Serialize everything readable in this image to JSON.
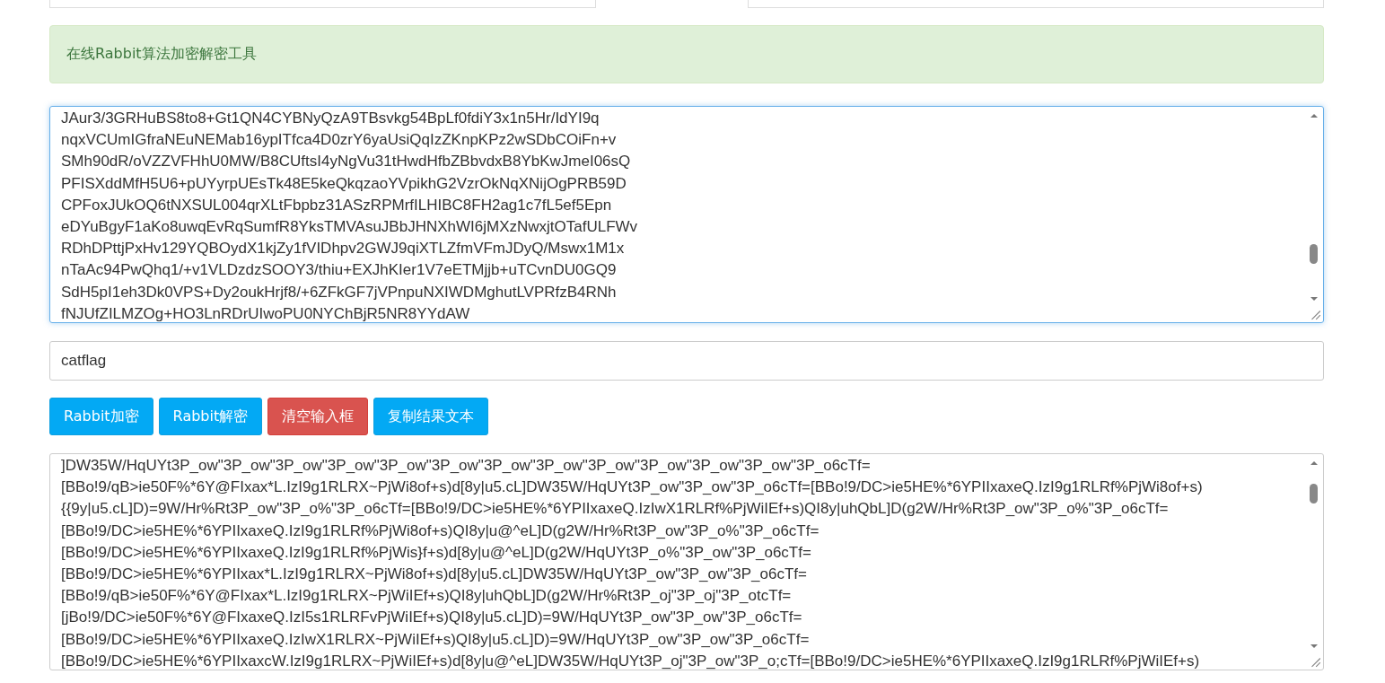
{
  "alert": {
    "text": "在线Rabbit算法加密解密工具"
  },
  "input_text": {
    "focused": true,
    "lines": [
      "JAur3/3GRHuBS8to8+Gt1QN4CYBNyQzA9TBsvkg54BpLf0fdiY3x1n5Hr/IdYI9q",
      "nqxVCUmIGfraNEuNEMab16ypITfca4D0zrY6yaUsiQqIzZKnpKPz2wSDbCOiFn+v",
      "SMh90dR/oVZZVFHhU0MW/B8CUftsI4yNgVu31tHwdHfbZBbvdxB8YbKwJmeI06sQ",
      "PFISXddMfH5U6+pUYyrpUEsTk48E5keQkqzaoYVpikhG2VzrOkNqXNijOgPRB59D",
      "CPFoxJUkOQ6tNXSUL004qrXLtFbpbz31ASzRPMrfILHIBC8FH2ag1c7fL5ef5Epn",
      "eDYuBgyF1aKo8uwqEvRqSumfR8YksTMVAsuJBbJHNXhWI6jMXzNwxjtOTafULFWv",
      "RDhDPttjPxHv129YQBOydX1kjZy1fVIDhpv2GWJ9qiXTLZfmVFmJDyQ/Mswx1M1x",
      "nTaAc94PwQhq1/+v1VLDzdzSOOY3/thiu+EXJhKIer1V7eETMjjb+uTCvnDU0GQ9",
      "SdH5pI1eh3Dk0VPS+Dy2oukHrjf8/+6ZFkGF7jVPnpuNXIWDMghutLVPRfzB4RNh",
      "fNJUfZILMZOg+HO3LnRDrUIwoPU0NYChBjR5NR8YYdAW"
    ]
  },
  "key": {
    "value": "catflag"
  },
  "buttons": [
    {
      "label": "Rabbit加密",
      "kind": "primary"
    },
    {
      "label": "Rabbit解密",
      "kind": "primary"
    },
    {
      "label": "清空输入框",
      "kind": "danger"
    },
    {
      "label": "复制结果文本",
      "kind": "primary"
    }
  ],
  "output_text": {
    "lines": [
      "]DW35W/HqUYt3P_ow\"3P_ow\"3P_ow\"3P_ow\"3P_ow\"3P_ow\"3P_ow\"3P_ow\"3P_ow\"3P_ow\"3P_ow\"3P_ow\"3P_o6cTf=",
      "[BBo!9/qB>ie50F%*6Y@FIxax*L.IzI9g1RLRX~PjWi8of+s)d[8y|u5.cL]DW35W/HqUYt3P_ow\"3P_ow\"3P_o6cTf=[BBo!9/DC>ie5HE%*6YPIIxaxeQ.IzI9g1RLRf%PjWi8of+s)",
      "{{9y|u5.cL]D)=9W/Hr%Rt3P_ow\"3P_o%\"3P_o6cTf=[BBo!9/DC>ie5HE%*6YPIIxaxeQ.IzIwX1RLRf%PjWiIEf+s)QI8y|uhQbL]D(g2W/Hr%Rt3P_ow\"3P_o%\"3P_o6cTf=",
      "[BBo!9/DC>ie5HE%*6YPIIxaxeQ.IzI9g1RLRf%PjWi8of+s)QI8y|u@^eL]D(g2W/Hr%Rt3P_ow\"3P_o%\"3P_o6cTf=",
      "[BBo!9/DC>ie5HE%*6YPIIxaxeQ.IzI9g1RLRf%PjWis}f+s)d[8y|u@^eL]D(g2W/HqUYt3P_o%\"3P_ow\"3P_o6cTf=",
      "[BBo!9/DC>ie5HE%*6YPIIxax*L.IzI9g1RLRX~PjWi8of+s)d[8y|u5.cL]DW35W/HqUYt3P_ow\"3P_ow\"3P_o6cTf=",
      "[BBo!9/qB>ie50F%*6Y@FIxax*L.IzI9g1RLRX~PjWiIEf+s)QI8y|uhQbL]D(g2W/Hr%Rt3P_oj\"3P_oj\"3P_otcTf=",
      "[jBo!9/DC>ie50F%*6Y@FIxaxeQ.IzI5s1RLRFvPjWiIEf+s)QI8y|u5.cL]D)=9W/HqUYt3P_ow\"3P_ow\"3P_o6cTf=",
      "[BBo!9/DC>ie5HE%*6YPIIxaxeQ.IzIwX1RLRX~PjWiIEf+s)QI8y|u5.cL]D)=9W/HqUYt3P_ow\"3P_ow\"3P_o6cTf=",
      "[BBo!9/DC>ie5HE%*6YPIIxaxcW.IzI9g1RLRX~PjWiIEf+s)d[8y|u@^eL]DW35W/HqUYt3P_oj\"3P_ow\"3P_o;cTf=[BBo!9/DC>ie5HE%*6YPIIxaxeQ.IzI9g1RLRf%PjWiIEf+s)"
    ]
  }
}
